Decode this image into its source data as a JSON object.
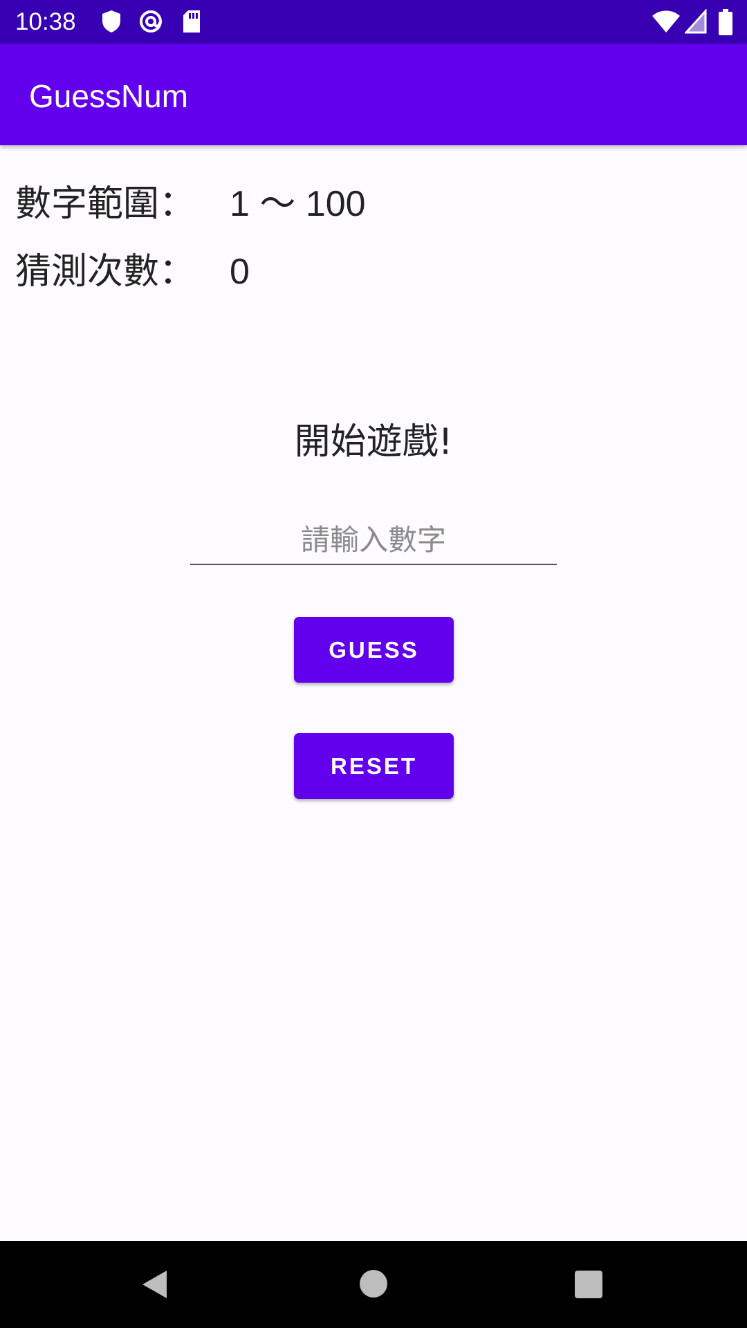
{
  "status_bar": {
    "time": "10:38",
    "icons": [
      "shield-icon",
      "at-sign-icon",
      "sd-card-icon",
      "wifi-icon",
      "signal-icon",
      "battery-icon"
    ]
  },
  "app_bar": {
    "title": "GuessNum"
  },
  "info": {
    "range_label": "數字範圍：",
    "range_value": "1 ～ 100",
    "count_label": "猜測次數：",
    "count_value": "0"
  },
  "message": "開始遊戲!",
  "input": {
    "placeholder": "請輸入數字",
    "value": ""
  },
  "buttons": {
    "guess": "GUESS",
    "reset": "RESET"
  },
  "nav_bar": {
    "icons": [
      "back-icon",
      "home-icon",
      "recents-icon"
    ]
  },
  "colors": {
    "primary": "#6200ee",
    "primary_dark": "#3700b3",
    "background": "#fdfbff"
  }
}
